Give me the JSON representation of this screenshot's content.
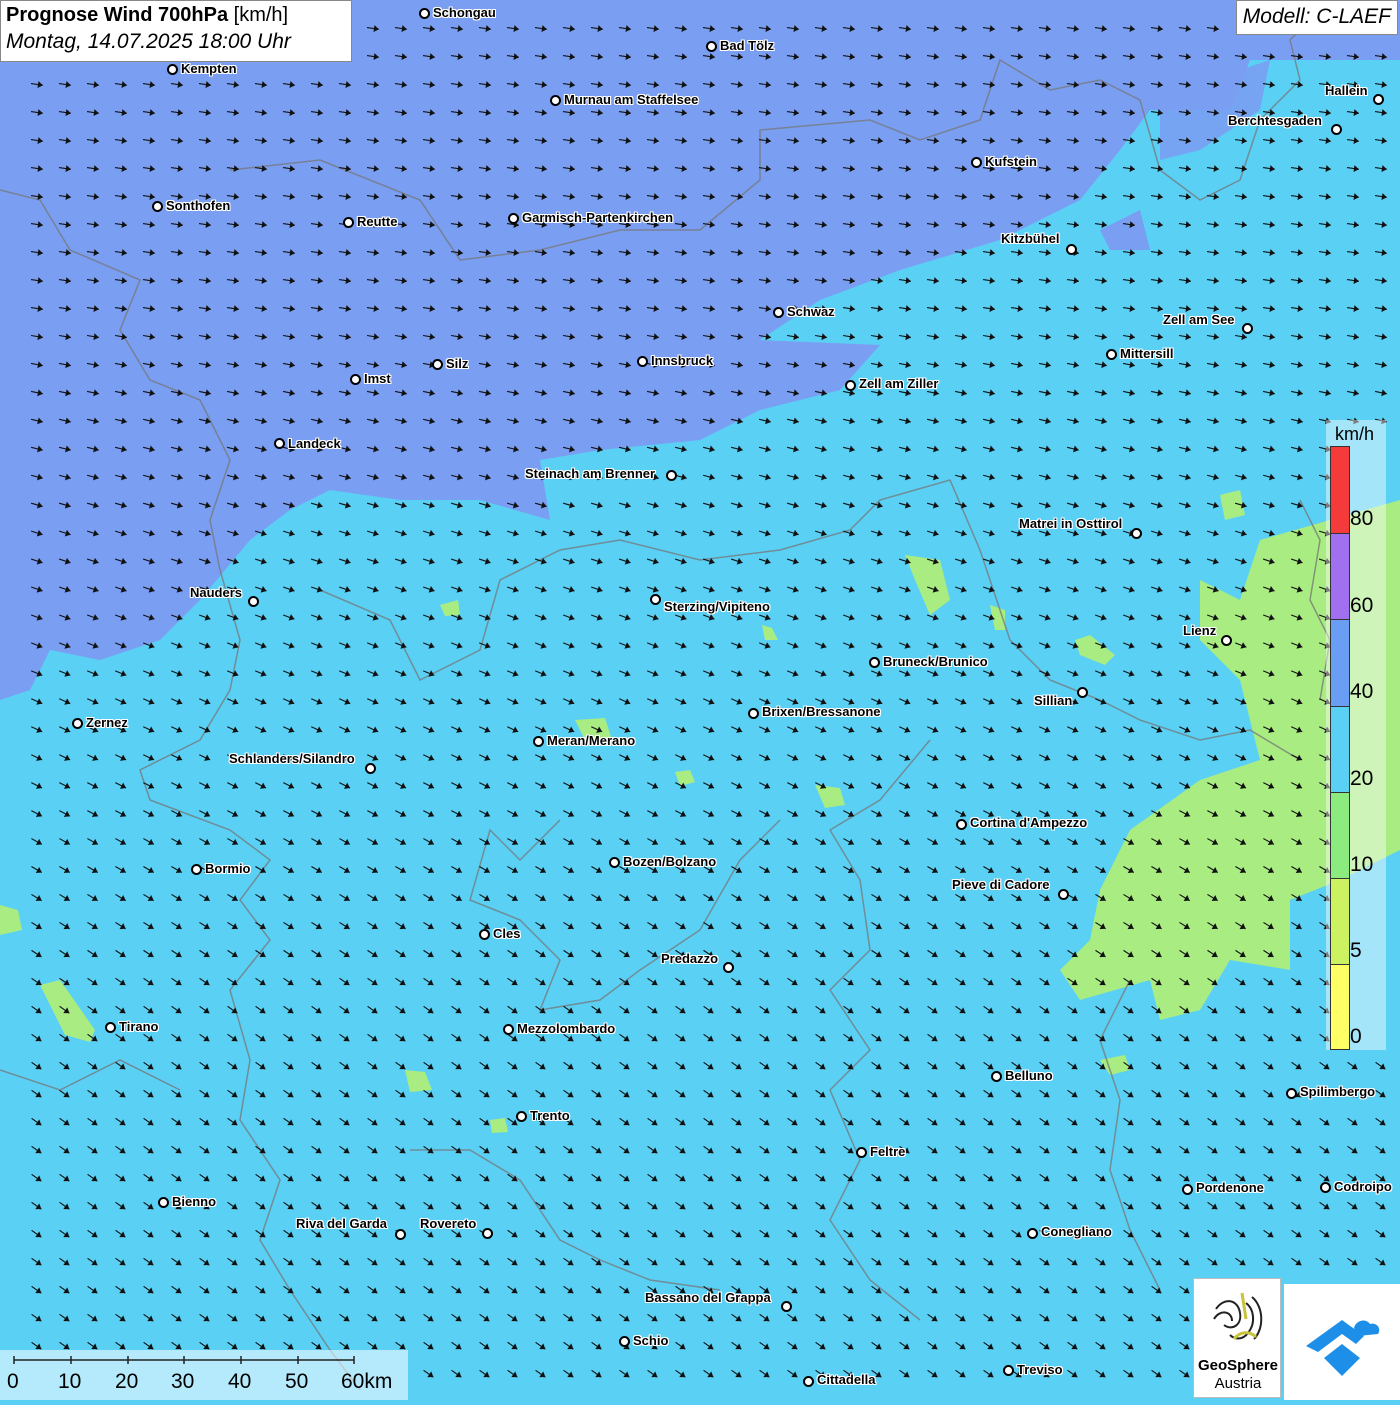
{
  "title": {
    "bold": "Prognose Wind 700hPa",
    "unit": "[km/h]",
    "datetime": "Montag, 14.07.2025 18:00 Uhr"
  },
  "model": "Modell: C-LAEF",
  "colors": {
    "band_0_5": "#ffff66",
    "band_5_10": "#ccf261",
    "band_10_20": "#8ceb7e",
    "band_20_40": "#5ad0f5",
    "band_40_60": "#6a9ef5",
    "band_60_80": "#a070f0",
    "band_80_plus": "#f43a3a",
    "region_main": "#5ad0f5",
    "region_north": "#7a9ef2",
    "region_calm": "#a8ec82"
  },
  "legend": {
    "unit": "km/h",
    "labels": [
      "0",
      "5",
      "10",
      "20",
      "40",
      "60",
      "80"
    ]
  },
  "scalebar": {
    "labels": [
      "0",
      "10",
      "20",
      "30",
      "40",
      "50",
      "60km"
    ]
  },
  "logos": {
    "geosphere_line1": "GeoSphere",
    "geosphere_line2": "Austria"
  },
  "wind": {
    "north_direction_deg": 8,
    "south_direction_deg": 35
  },
  "cities": [
    {
      "name": "Schongau",
      "dot": [
        424,
        13
      ],
      "label": [
        433,
        6
      ]
    },
    {
      "name": "Bad Tölz",
      "dot": [
        711,
        46
      ],
      "label": [
        720,
        39
      ]
    },
    {
      "name": "Kempten",
      "dot": [
        172,
        69
      ],
      "label": [
        181,
        62
      ]
    },
    {
      "name": "Murnau am Staffelsee",
      "dot": [
        555,
        100
      ],
      "label": [
        564,
        93
      ]
    },
    {
      "name": "Hallein",
      "dot": [
        1378,
        99
      ],
      "label": [
        1325,
        84
      ]
    },
    {
      "name": "Berchtesgaden",
      "dot": [
        1336,
        129
      ],
      "label": [
        1228,
        114
      ]
    },
    {
      "name": "Kufstein",
      "dot": [
        976,
        162
      ],
      "label": [
        985,
        155
      ]
    },
    {
      "name": "Sonthofen",
      "dot": [
        157,
        206
      ],
      "label": [
        166,
        199
      ]
    },
    {
      "name": "Reutte",
      "dot": [
        348,
        222
      ],
      "label": [
        357,
        215
      ]
    },
    {
      "name": "Garmisch-Partenkirchen",
      "dot": [
        513,
        218
      ],
      "label": [
        522,
        211
      ]
    },
    {
      "name": "Kitzbühel",
      "dot": [
        1071,
        249
      ],
      "label": [
        1001,
        232
      ]
    },
    {
      "name": "Schwaz",
      "dot": [
        778,
        312
      ],
      "label": [
        787,
        305
      ]
    },
    {
      "name": "Zell am See",
      "dot": [
        1247,
        328
      ],
      "label": [
        1163,
        313
      ]
    },
    {
      "name": "Mittersill",
      "dot": [
        1111,
        354
      ],
      "label": [
        1120,
        347
      ]
    },
    {
      "name": "Innsbruck",
      "dot": [
        642,
        361
      ],
      "label": [
        651,
        354
      ]
    },
    {
      "name": "Silz",
      "dot": [
        437,
        364
      ],
      "label": [
        446,
        357
      ]
    },
    {
      "name": "Imst",
      "dot": [
        355,
        379
      ],
      "label": [
        364,
        372
      ]
    },
    {
      "name": "Zell am Ziller",
      "dot": [
        850,
        385
      ],
      "label": [
        859,
        377
      ]
    },
    {
      "name": "Landeck",
      "dot": [
        279,
        443
      ],
      "label": [
        288,
        437
      ]
    },
    {
      "name": "Steinach am Brenner",
      "dot": [
        671,
        475
      ],
      "label": [
        525,
        467
      ]
    },
    {
      "name": "Matrei in Osttirol",
      "dot": [
        1136,
        533
      ],
      "label": [
        1019,
        517
      ]
    },
    {
      "name": "Nauders",
      "dot": [
        253,
        601
      ],
      "label": [
        190,
        586
      ]
    },
    {
      "name": "Sterzing/Vipiteno",
      "dot": [
        655,
        599
      ],
      "label": [
        664,
        600
      ]
    },
    {
      "name": "Lienz",
      "dot": [
        1226,
        640
      ],
      "label": [
        1183,
        624
      ]
    },
    {
      "name": "Bruneck/Brunico",
      "dot": [
        874,
        662
      ],
      "label": [
        883,
        655
      ]
    },
    {
      "name": "Sillian",
      "dot": [
        1082,
        692
      ],
      "label": [
        1034,
        694
      ]
    },
    {
      "name": "Brixen/Bressanone",
      "dot": [
        753,
        713
      ],
      "label": [
        762,
        705
      ]
    },
    {
      "name": "Zernez",
      "dot": [
        77,
        723
      ],
      "label": [
        86,
        716
      ]
    },
    {
      "name": "Meran/Merano",
      "dot": [
        538,
        741
      ],
      "label": [
        547,
        734
      ]
    },
    {
      "name": "Schlanders/Silandro",
      "dot": [
        370,
        768
      ],
      "label": [
        229,
        752
      ]
    },
    {
      "name": "Cortina d'Ampezzo",
      "dot": [
        961,
        824
      ],
      "label": [
        970,
        816
      ]
    },
    {
      "name": "Bozen/Bolzano",
      "dot": [
        614,
        862
      ],
      "label": [
        623,
        855
      ]
    },
    {
      "name": "Bormio",
      "dot": [
        196,
        869
      ],
      "label": [
        205,
        862
      ]
    },
    {
      "name": "Pieve di Cadore",
      "dot": [
        1063,
        894
      ],
      "label": [
        952,
        878
      ]
    },
    {
      "name": "Cles",
      "dot": [
        484,
        934
      ],
      "label": [
        493,
        927
      ]
    },
    {
      "name": "Predazzo",
      "dot": [
        728,
        967
      ],
      "label": [
        661,
        952
      ]
    },
    {
      "name": "Tirano",
      "dot": [
        110,
        1027
      ],
      "label": [
        119,
        1020
      ]
    },
    {
      "name": "Mezzolombardo",
      "dot": [
        508,
        1029
      ],
      "label": [
        517,
        1022
      ]
    },
    {
      "name": "Belluno",
      "dot": [
        996,
        1076
      ],
      "label": [
        1005,
        1069
      ]
    },
    {
      "name": "Spilimbergo",
      "dot": [
        1291,
        1093
      ],
      "label": [
        1300,
        1085
      ]
    },
    {
      "name": "Trento",
      "dot": [
        521,
        1116
      ],
      "label": [
        530,
        1109
      ]
    },
    {
      "name": "Feltre",
      "dot": [
        861,
        1152
      ],
      "label": [
        870,
        1145
      ]
    },
    {
      "name": "Pordenone",
      "dot": [
        1187,
        1189
      ],
      "label": [
        1196,
        1181
      ]
    },
    {
      "name": "Codroipo",
      "dot": [
        1325,
        1187
      ],
      "label": [
        1334,
        1180
      ]
    },
    {
      "name": "Bienno",
      "dot": [
        163,
        1202
      ],
      "label": [
        172,
        1195
      ]
    },
    {
      "name": "Riva del Garda",
      "dot": [
        400,
        1234
      ],
      "label": [
        296,
        1217
      ]
    },
    {
      "name": "Rovereto",
      "dot": [
        487,
        1233
      ],
      "label": [
        420,
        1217
      ]
    },
    {
      "name": "Conegliano",
      "dot": [
        1032,
        1233
      ],
      "label": [
        1041,
        1225
      ]
    },
    {
      "name": "Bassano del Grappa",
      "dot": [
        786,
        1306
      ],
      "label": [
        645,
        1291
      ]
    },
    {
      "name": "Schio",
      "dot": [
        624,
        1341
      ],
      "label": [
        633,
        1334
      ]
    },
    {
      "name": "Treviso",
      "dot": [
        1008,
        1370
      ],
      "label": [
        1017,
        1363
      ]
    },
    {
      "name": "Cittadella",
      "dot": [
        808,
        1381
      ],
      "label": [
        817,
        1373
      ]
    }
  ]
}
